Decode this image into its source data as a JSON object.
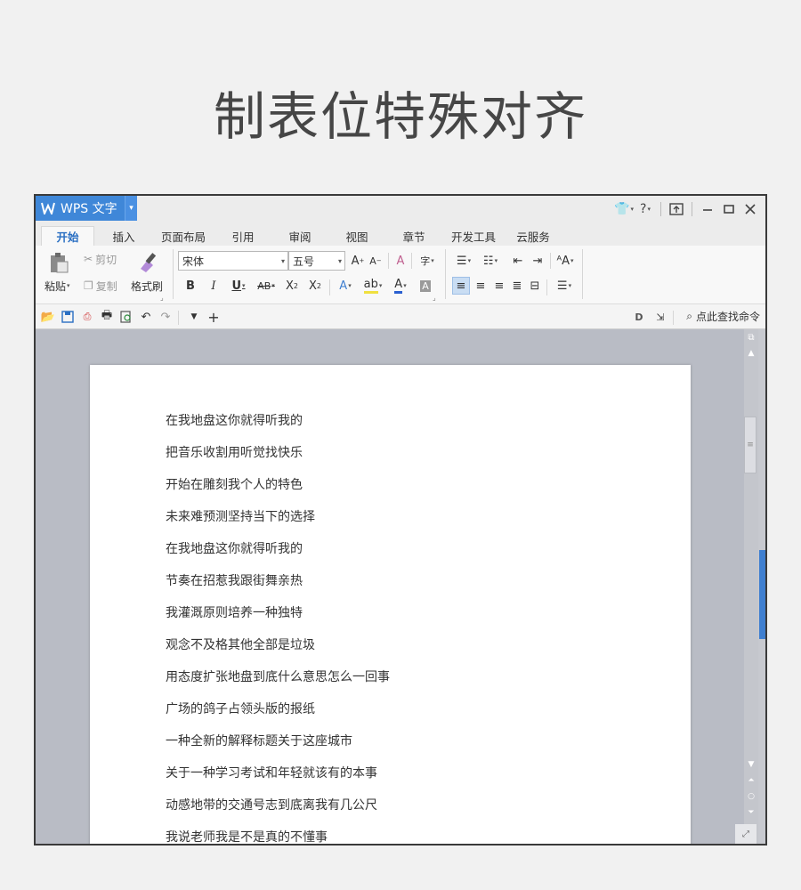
{
  "heading": "制表位特殊对齐",
  "window": {
    "app_name": "WPS 文字",
    "tabs": [
      "开始",
      "插入",
      "页面布局",
      "引用",
      "审阅",
      "视图",
      "章节",
      "开发工具",
      "云服务"
    ],
    "active_tab": "开始"
  },
  "ribbon": {
    "paste_label": "粘贴",
    "cut_label": "剪切",
    "copy_label": "复制",
    "format_painter_label": "格式刷",
    "font_name": "宋体",
    "font_size": "五号"
  },
  "quick_access": {
    "find_command_label": "点此查找命令"
  },
  "document": {
    "lines": [
      "在我地盘这你就得听我的",
      "把音乐收割用听觉找快乐",
      "开始在雕刻我个人的特色",
      "未来难预测坚持当下的选择",
      "在我地盘这你就得听我的",
      "节奏在招惹我跟街舞亲热",
      "我灌溉原则培养一种独特",
      "观念不及格其他全部是垃圾",
      "用态度扩张地盘到底什么意思怎么一回事",
      "广场的鸽子占领头版的报纸",
      "一种全新的解释标题关于这座城市",
      "关于一种学习考试和年轻就该有的本事",
      "动感地带的交通号志到底离我有几公尺",
      "我说老师我是不是真的不懂事"
    ]
  },
  "colors": {
    "accent": "#3f87d8",
    "doc_background": "#b9bcc5",
    "page_background": "#f1f1f1"
  }
}
